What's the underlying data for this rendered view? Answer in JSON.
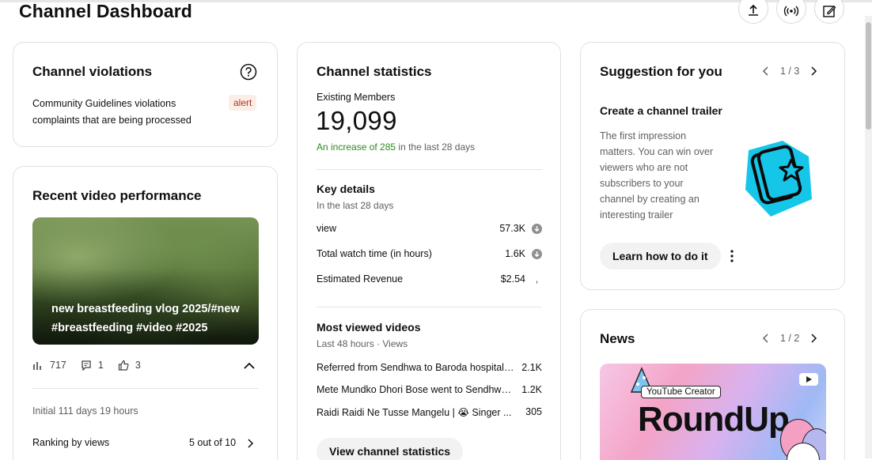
{
  "page": {
    "title": "Channel Dashboard"
  },
  "header_actions": [
    "upload-icon",
    "go-live-icon",
    "create-post-icon"
  ],
  "violations": {
    "title": "Channel violations",
    "help_icon": "help-circle-icon",
    "description": "Community Guidelines violations complaints that are being processed",
    "badge": "alert"
  },
  "recent_video": {
    "title": "Recent video performance",
    "video_title": "new breastfeeding vlog 2025/#new #breastfeeding #video #2025",
    "views": "717",
    "comments": "1",
    "likes": "3",
    "initial": "Initial 111 days 19 hours",
    "ranking_label": "Ranking by views",
    "ranking_value": "5 out of 10"
  },
  "stats": {
    "title": "Channel statistics",
    "members_label": "Existing Members",
    "members_value": "19,099",
    "increase_prefix": "An increase of 285",
    "increase_suffix": " in the last 28 days",
    "key_details": {
      "title": "Key details",
      "subtitle": "In the last 28 days",
      "rows": [
        {
          "label": "view",
          "value": "57.3K",
          "trend": "down"
        },
        {
          "label": "Total watch time (in hours)",
          "value": "1.6K",
          "trend": "down"
        },
        {
          "label": "Estimated Revenue",
          "value": "$2.54",
          "trend": ","
        }
      ]
    },
    "most_viewed": {
      "title": "Most viewed videos",
      "subtitle": "Last 48 hours · Views",
      "rows": [
        {
          "title": "Referred from Sendhwa to Baroda hospital and...",
          "views": "2.1K"
        },
        {
          "title": "Mete Mundko Dhori Bose went to Sendhwa...",
          "views": "1.2K"
        },
        {
          "title": "Raidi Raidi Ne Tusse Mangelu | 😭 Singer ...",
          "views": "305"
        }
      ]
    },
    "button": "View channel statistics"
  },
  "suggestion": {
    "title": "Suggestion for you",
    "pager": "1 / 3",
    "heading": "Create a channel trailer",
    "body": "The first impression matters. You can win over viewers who are not subscribers to your channel by creating an interesting trailer",
    "button": "Learn how to do it"
  },
  "news": {
    "title": "News",
    "pager": "1 / 2",
    "image_label": "YouTube Creator",
    "image_text": "RoundUp"
  },
  "colors": {
    "increase_green": "#2b8a1e",
    "alert_bg": "#fbeee7",
    "alert_text": "#b4331b",
    "trailer_cyan": "#16c6e8"
  }
}
